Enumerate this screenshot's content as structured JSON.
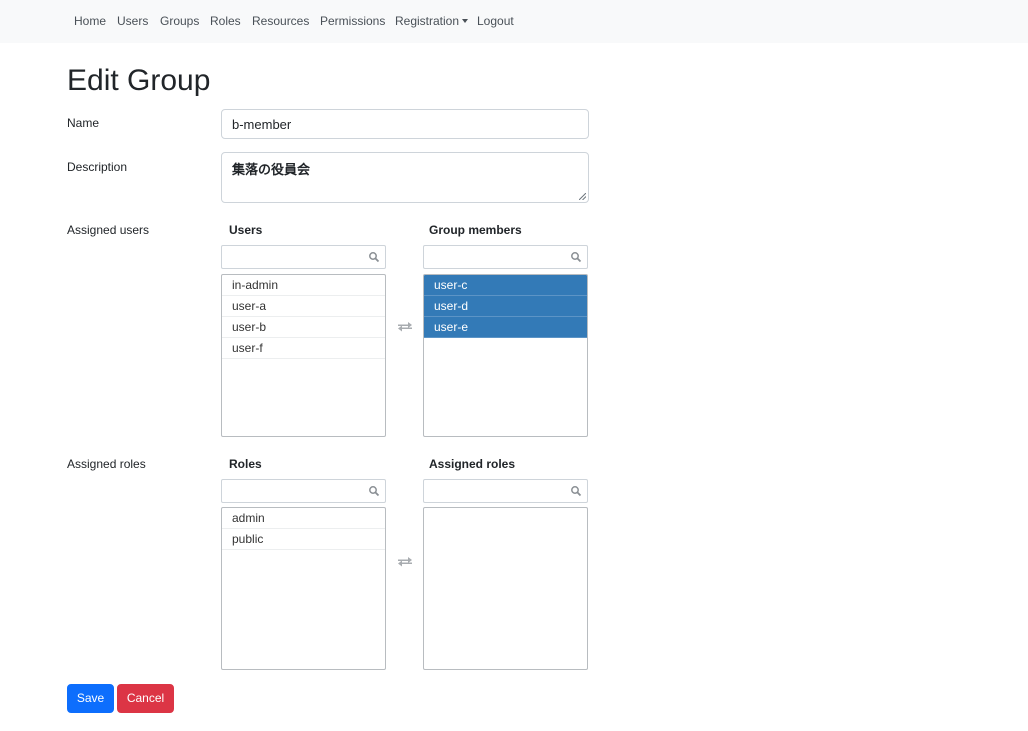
{
  "nav": {
    "items": [
      "Home",
      "Users",
      "Groups",
      "Roles",
      "Resources",
      "Permissions",
      "Registration",
      "Logout"
    ]
  },
  "page": {
    "title": "Edit Group"
  },
  "form": {
    "name_label": "Name",
    "name_value": "b-member",
    "description_label": "Description",
    "description_value": "集落の役員会",
    "assigned_users_label": "Assigned users",
    "assigned_roles_label": "Assigned roles"
  },
  "users_picker": {
    "available_title": "Users",
    "available": [
      "in-admin",
      "user-a",
      "user-b",
      "user-f"
    ],
    "selected_title": "Group members",
    "selected": [
      "user-c",
      "user-d",
      "user-e"
    ]
  },
  "roles_picker": {
    "available_title": "Roles",
    "available": [
      "admin",
      "public"
    ],
    "selected_title": "Assigned roles",
    "selected": []
  },
  "buttons": {
    "save": "Save",
    "cancel": "Cancel"
  },
  "colors": {
    "selected_item": "#337ab7",
    "save": "#0d6efd",
    "cancel": "#dc3545"
  }
}
